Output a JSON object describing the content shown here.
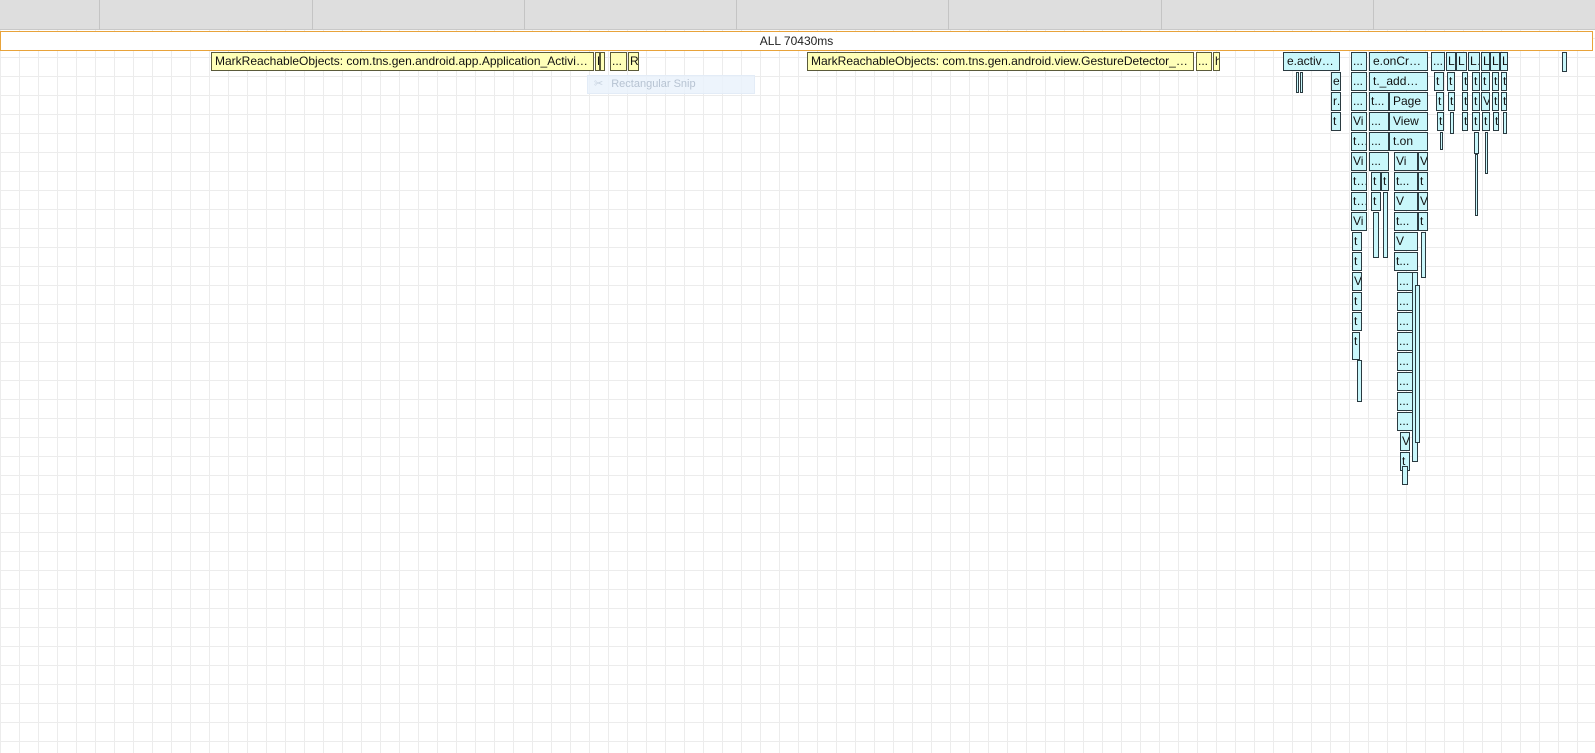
{
  "header": {
    "all_label": "ALL 70430ms"
  },
  "snip_tool": {
    "icon": "scissors-icon",
    "label": "Rectangular Snip"
  },
  "frames": {
    "mark1": "MarkReachableObjects: com.tns.gen.android.app.Application_ActivityLifecycleCallbacks",
    "mark2": "MarkReachableObjects: com.tns.gen.android.view.GestureDetector_SimpleOnGestureListener",
    "m1": "M",
    "dots": "...",
    "r": "R",
    "h": "h",
    "activate": "e.activate",
    "oncreate": "e.onCreate",
    "addview": "t._addView",
    "page": "Page",
    "view": "View",
    "viewlong": "View",
    "ton": "t.on",
    "v": "V",
    "vi": "Vi",
    "t": "t",
    "tdot": "t.c",
    "e": "e",
    "rdot": "r.",
    "l": "L",
    "li": "Li",
    "tdots": "t..."
  },
  "colors": {
    "frame_yellow": "#ffffb8",
    "frame_cyan": "#c9f7fb",
    "all_border": "#e8a33a"
  }
}
